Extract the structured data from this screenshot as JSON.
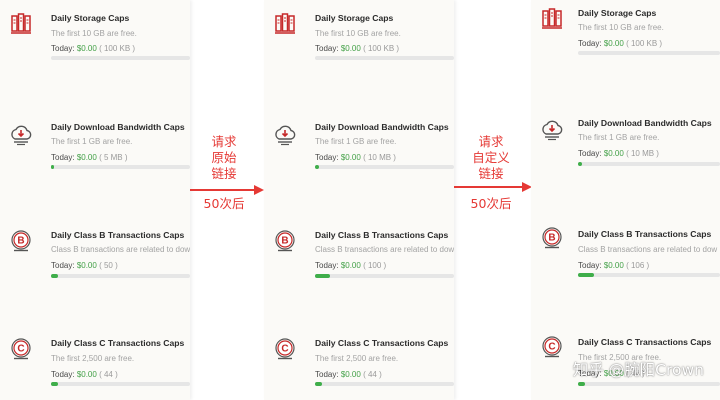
{
  "panels": [
    {
      "cards": [
        {
          "title": "Daily Storage Caps",
          "desc": "The first 10 GB are free.",
          "today_label": "Today:",
          "value": "$0.00",
          "detail": "( 100 KB )",
          "progress": 0.0,
          "icon": "server-stack-icon"
        },
        {
          "title": "Daily Download Bandwidth Caps",
          "desc": "The first 1 GB are free.",
          "today_label": "Today:",
          "value": "$0.00",
          "detail": "( 5 MB )",
          "progress": 0.02,
          "icon": "cloud-download-icon"
        },
        {
          "title": "Daily Class B Transactions Caps",
          "desc": "Class B transactions are related to dow",
          "today_label": "Today:",
          "value": "$0.00",
          "detail": "( 50 )",
          "progress": 0.05,
          "icon": "class-b-icon"
        },
        {
          "title": "Daily Class C Transactions Caps",
          "desc": "The first 2,500 are free.",
          "today_label": "Today:",
          "value": "$0.00",
          "detail": "( 44 )",
          "progress": 0.05,
          "icon": "class-c-icon"
        }
      ]
    },
    {
      "cards": [
        {
          "title": "Daily Storage Caps",
          "desc": "The first 10 GB are free.",
          "today_label": "Today:",
          "value": "$0.00",
          "detail": "( 100 KB )",
          "progress": 0.0,
          "icon": "server-stack-icon"
        },
        {
          "title": "Daily Download Bandwidth Caps",
          "desc": "The first 1 GB are free.",
          "today_label": "Today:",
          "value": "$0.00",
          "detail": "( 10 MB )",
          "progress": 0.03,
          "icon": "cloud-download-icon"
        },
        {
          "title": "Daily Class B Transactions Caps",
          "desc": "Class B transactions are related to dow",
          "today_label": "Today:",
          "value": "$0.00",
          "detail": "( 100 )",
          "progress": 0.11,
          "icon": "class-b-icon"
        },
        {
          "title": "Daily Class C Transactions Caps",
          "desc": "The first 2,500 are free.",
          "today_label": "Today:",
          "value": "$0.00",
          "detail": "( 44 )",
          "progress": 0.05,
          "icon": "class-c-icon"
        }
      ]
    },
    {
      "cards": [
        {
          "title": "Daily Storage Caps",
          "desc": "The first 10 GB are free.",
          "today_label": "Today:",
          "value": "$0.00",
          "detail": "( 100 KB )",
          "progress": 0.0,
          "icon": "server-stack-icon"
        },
        {
          "title": "Daily Download Bandwidth Caps",
          "desc": "The first 1 GB are free.",
          "today_label": "Today:",
          "value": "$0.00",
          "detail": "( 10 MB )",
          "progress": 0.03,
          "icon": "cloud-download-icon"
        },
        {
          "title": "Daily Class B Transactions Caps",
          "desc": "Class B transactions are related to dow",
          "today_label": "Today:",
          "value": "$0.00",
          "detail": "( 106 )",
          "progress": 0.11,
          "icon": "class-b-icon"
        },
        {
          "title": "Daily Class C Transactions Caps",
          "desc": "The first 2,500 are free.",
          "today_label": "Today:",
          "value": "$0.00",
          "detail": "( 44 )",
          "progress": 0.05,
          "icon": "class-c-icon"
        }
      ]
    }
  ],
  "annotations": [
    {
      "lines": [
        "请求",
        "原始",
        "链接"
      ],
      "count": "50次后"
    },
    {
      "lines": [
        "请求",
        "自定义",
        "链接"
      ],
      "count": "50次后"
    }
  ],
  "watermark": "知乎 @腕阳Crown",
  "colors": {
    "accent": "#e53935",
    "icon_red": "#c62828",
    "value_green": "#43a047",
    "bar_green": "#3fae4a",
    "bar_track": "#e6e6e6",
    "panel_bg": "#fbfaf7"
  }
}
